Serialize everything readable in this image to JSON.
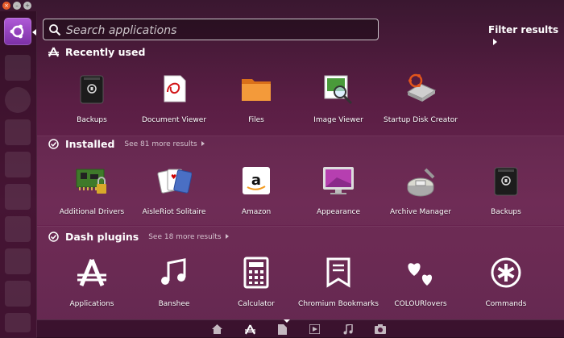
{
  "search": {
    "placeholder": "Search applications",
    "value": ""
  },
  "filter": {
    "label": "Filter results"
  },
  "sections": [
    {
      "title": "Recently used",
      "see_more": "",
      "items": [
        {
          "label": "Backups",
          "icon": "backups-icon"
        },
        {
          "label": "Document Viewer",
          "icon": "document-viewer-icon"
        },
        {
          "label": "Files",
          "icon": "folder-icon"
        },
        {
          "label": "Image Viewer",
          "icon": "image-viewer-icon"
        },
        {
          "label": "Startup Disk Creator",
          "icon": "startup-disk-icon"
        }
      ]
    },
    {
      "title": "Installed",
      "see_more": "See 81 more results",
      "items": [
        {
          "label": "Additional Drivers",
          "icon": "drivers-icon"
        },
        {
          "label": "AisleRiot Solitaire",
          "icon": "cards-icon"
        },
        {
          "label": "Amazon",
          "icon": "amazon-icon"
        },
        {
          "label": "Appearance",
          "icon": "appearance-icon"
        },
        {
          "label": "Archive Manager",
          "icon": "archive-icon"
        },
        {
          "label": "Backups",
          "icon": "backups-icon"
        }
      ]
    },
    {
      "title": "Dash plugins",
      "see_more": "See 18 more results",
      "items": [
        {
          "label": "Applications",
          "icon": "applications-icon"
        },
        {
          "label": "Banshee",
          "icon": "music-icon"
        },
        {
          "label": "Calculator",
          "icon": "calculator-icon"
        },
        {
          "label": "Chromium Bookmarks",
          "icon": "bookmark-icon"
        },
        {
          "label": "COLOURlovers",
          "icon": "hearts-icon"
        },
        {
          "label": "Commands",
          "icon": "asterisk-icon"
        }
      ]
    }
  ],
  "colors": {
    "accent": "#7b2fa5",
    "background": "#5a1e44",
    "folder": "#f08a24",
    "amazon_orange": "#f39a1e"
  }
}
